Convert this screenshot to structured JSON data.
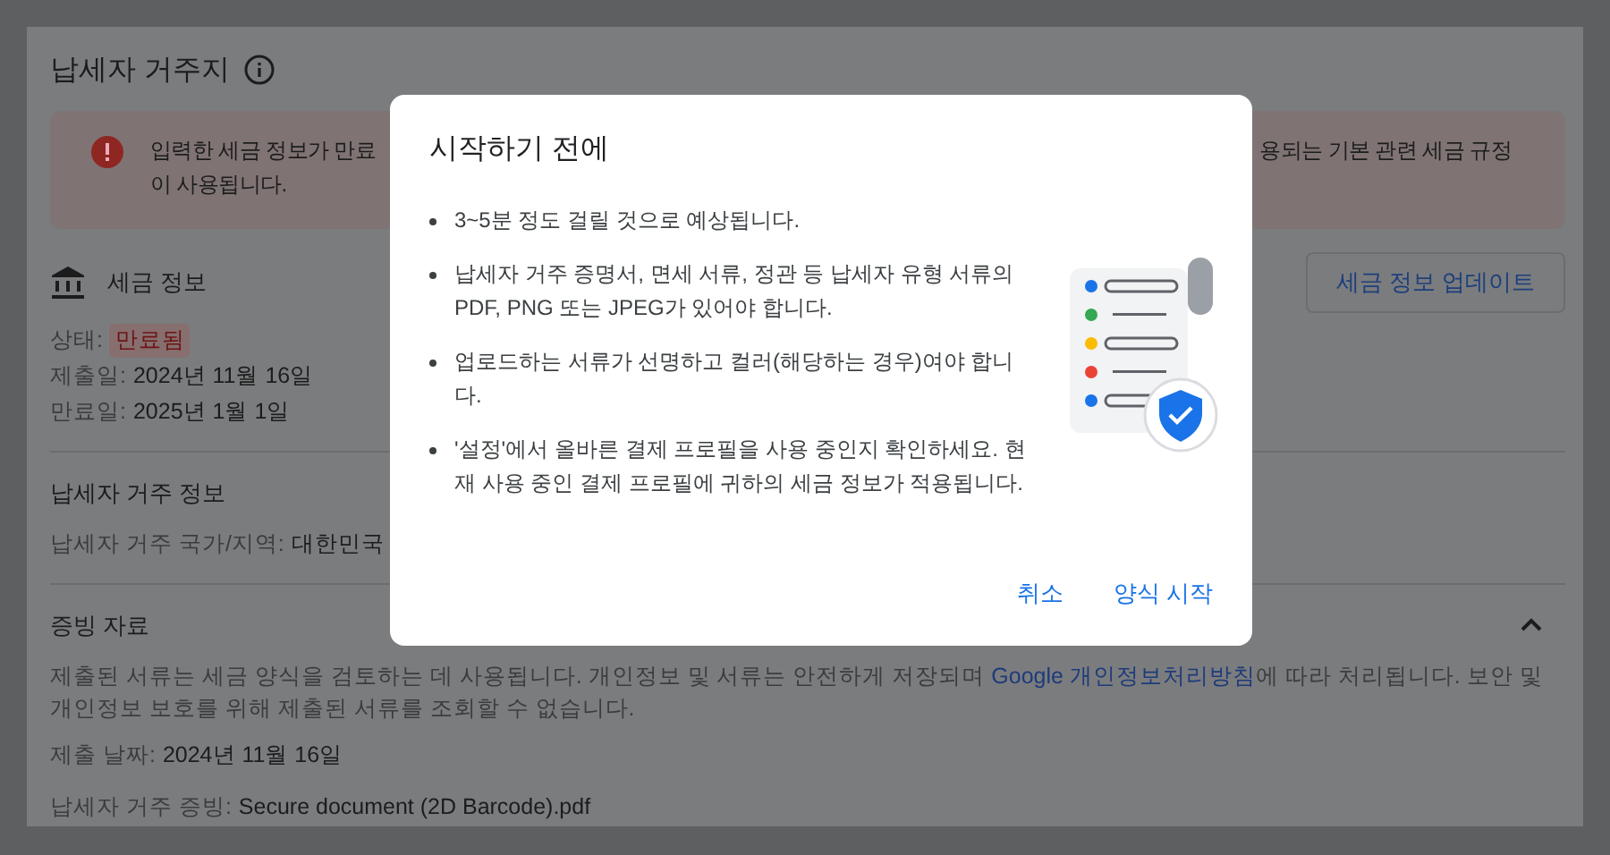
{
  "page": {
    "title": "납세자 거주지",
    "alert": {
      "line_1_start": "입력한 세금 정보가 만료",
      "line_1_end": "용되는 기본 관련 세금 규정",
      "line_2": "이 사용됩니다."
    },
    "tax_info": {
      "label": "세금 정보",
      "button": "세금 정보 업데이트",
      "fields": [
        {
          "label": "상태:",
          "value": "만료됨",
          "kind": "chip"
        },
        {
          "label": "제출일:",
          "value": "2024년 11월 16일",
          "kind": "plain"
        },
        {
          "label": "만료일:",
          "value": "2025년 1월 1일",
          "kind": "plain"
        }
      ]
    },
    "residence": {
      "heading": "납세자 거주 정보",
      "fields": [
        {
          "label": "납세자 거주 국가/지역:",
          "value": "대한민국"
        }
      ]
    },
    "documents": {
      "heading": "증빙 자료",
      "expanded": true,
      "text_before": "제출된 서류는 세금 양식을 검토하는 데 사용됩니다. 개인정보 및 서류는 안전하게 저장되며 ",
      "link": "Google 개인정보처리방침",
      "text_after": "에 따라 처리됩니다. 보안 및 개인정보 보호를 위해 제출된 서류를 조회할 수 없습니다.",
      "fields": [
        {
          "label": "제출 날짜:",
          "value": "2024년 11월 16일"
        },
        {
          "label": "납세자 거주 증빙:",
          "value": "Secure document (2D Barcode).pdf"
        }
      ]
    }
  },
  "dialog": {
    "title": "시작하기 전에",
    "bullets": [
      "3~5분 정도 걸릴 것으로 예상됩니다.",
      "납세자 거주 증명서, 면세 서류, 정관 등 납세자 유형 서류의 PDF, PNG 또는 JPEG가 있어야 합니다.",
      "업로드하는 서류가 선명하고 컬러(해당하는 경우)여야 합니다.",
      "'설정'에서 올바른 결제 프로필을 사용 중인지 확인하세요. 현재 사용 중인 결제 프로필에 귀하의 세금 정보가 적용됩니다."
    ],
    "buttons": [
      "취소",
      "양식 시작"
    ]
  }
}
